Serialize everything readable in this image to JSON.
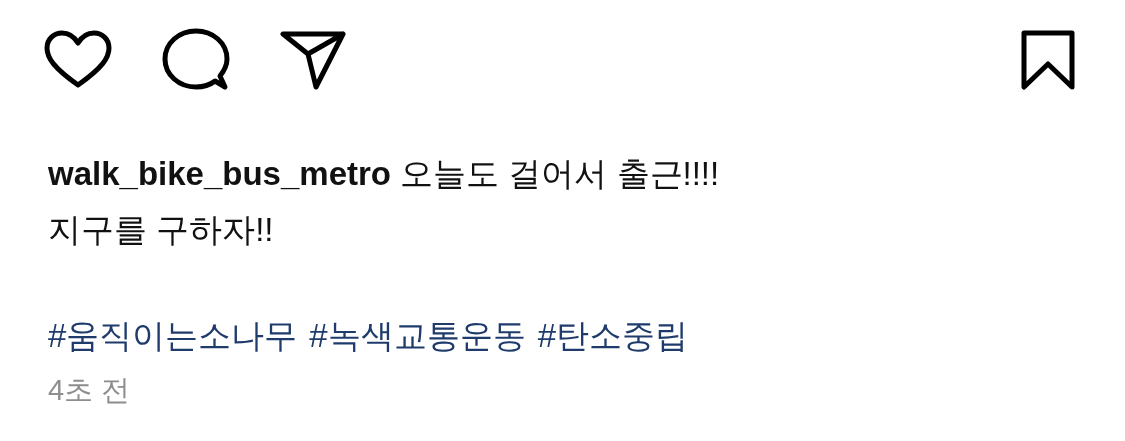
{
  "actions": [
    {
      "kind": "like"
    },
    {
      "kind": "comment"
    },
    {
      "kind": "share"
    },
    {
      "kind": "save"
    }
  ],
  "caption": "**walk_bike_bus_metro** 오늘도 걸어서 출근!!!!\n지구를 구하자!!",
  "hashtags": [
    "#움직이는소나무",
    "#녹색교통운동",
    "#탄소중립"
  ],
  "time": "4초 전"
}
